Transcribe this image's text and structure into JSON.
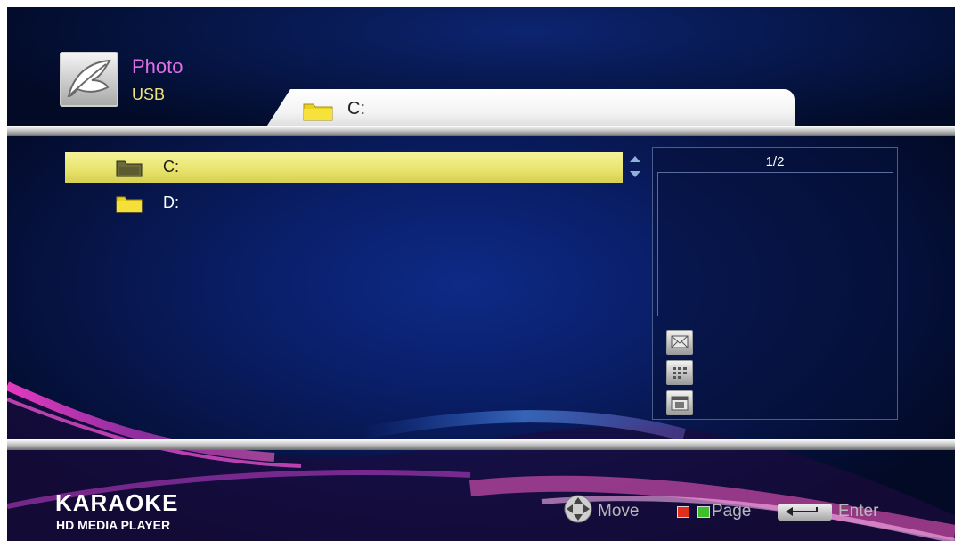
{
  "header": {
    "app_title": "Photo",
    "source": "USB",
    "app_icon": "photo-leaf-icon",
    "path_tab": {
      "icon": "folder-icon",
      "text": "C:"
    }
  },
  "file_list": {
    "items": [
      {
        "label": "C:",
        "icon": "folder-open-icon",
        "selected": true
      },
      {
        "label": "D:",
        "icon": "folder-icon",
        "selected": false
      }
    ],
    "scroll_icons": [
      "scroll-up-icon",
      "scroll-down-icon"
    ]
  },
  "preview": {
    "page": "1/2",
    "buttons": [
      "slideshow-icon",
      "thumbnail-grid-icon",
      "calendar-icon"
    ]
  },
  "brand": {
    "main": "KARAOKE",
    "sub": "HD MEDIA PLAYER"
  },
  "footer": {
    "move_label": "Move",
    "page_label": "Page",
    "enter_label": "Enter",
    "colors": {
      "red_key": "#e42e1d",
      "green_key": "#3fbe2b"
    }
  },
  "colors": {
    "title_pink": "#e06ee8",
    "source_yellow": "#f1e57a",
    "selection_yellow": "#e7e36a",
    "background_blue": "#0a1f6a"
  }
}
